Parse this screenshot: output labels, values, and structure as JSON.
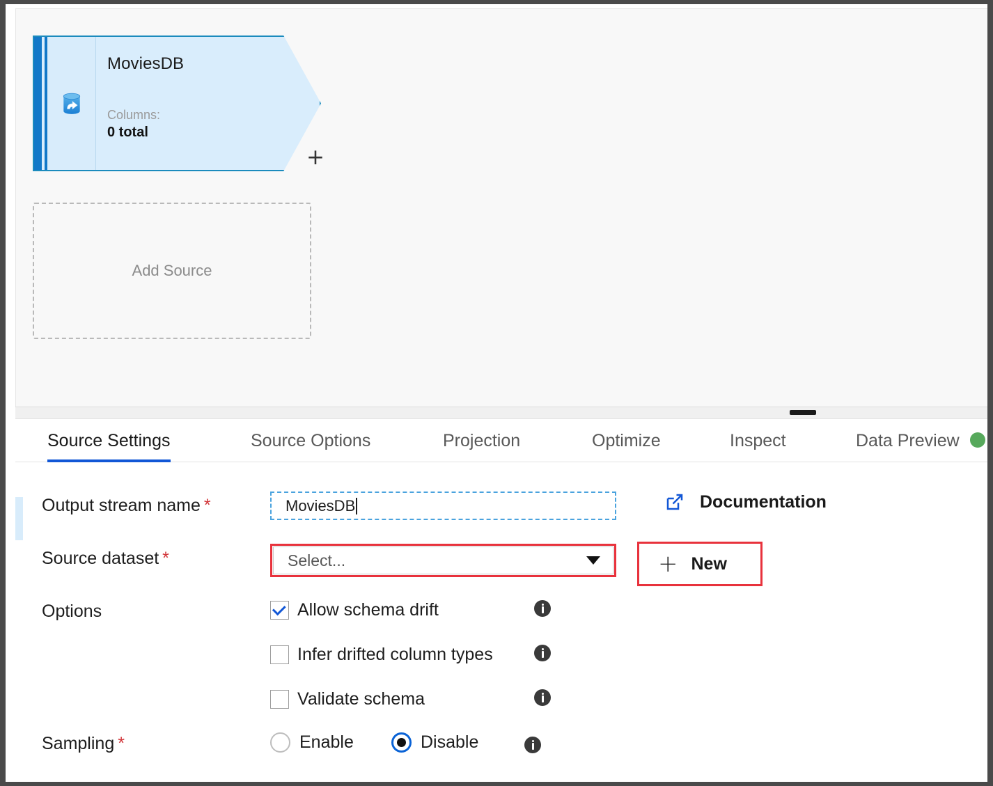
{
  "canvas": {
    "source_node": {
      "title": "MoviesDB",
      "columns_label": "Columns:",
      "columns_value": "0 total",
      "icon": "database-source-icon",
      "plus": "+",
      "accent": "#1278c8",
      "fill": "#d9edfc",
      "outline": "#1b8bbd"
    },
    "add_source": {
      "label": "Add Source"
    }
  },
  "tabs": [
    {
      "label": "Source Settings",
      "active": true
    },
    {
      "label": "Source Options",
      "active": false
    },
    {
      "label": "Projection",
      "active": false
    },
    {
      "label": "Optimize",
      "active": false
    },
    {
      "label": "Inspect",
      "active": false
    },
    {
      "label": "Data Preview",
      "active": false
    }
  ],
  "tab_status_dot": {
    "color": "#57a95c",
    "name": "data-preview-status-dot"
  },
  "form": {
    "output_stream": {
      "label": "Output stream name",
      "required_marker": "*",
      "value": "MoviesDB"
    },
    "source_dataset": {
      "label": "Source dataset",
      "required_marker": "*",
      "selected": "Select...",
      "options": [
        "Select..."
      ],
      "highlight_color": "#e8323c"
    },
    "documentation": {
      "label": "Documentation",
      "icon": "external-link-icon",
      "icon_color": "#1257d6"
    },
    "new_button": {
      "label": "New",
      "plus": "+",
      "highlight_color": "#e8323c"
    },
    "options": {
      "label": "Options",
      "items": [
        {
          "label": "Allow schema drift",
          "checked": true
        },
        {
          "label": "Infer drifted column types",
          "checked": false
        },
        {
          "label": "Validate schema",
          "checked": false
        }
      ]
    },
    "sampling": {
      "label": "Sampling",
      "required_marker": "*",
      "choices": [
        {
          "label": "Enable",
          "selected": false
        },
        {
          "label": "Disable",
          "selected": true
        }
      ]
    }
  }
}
